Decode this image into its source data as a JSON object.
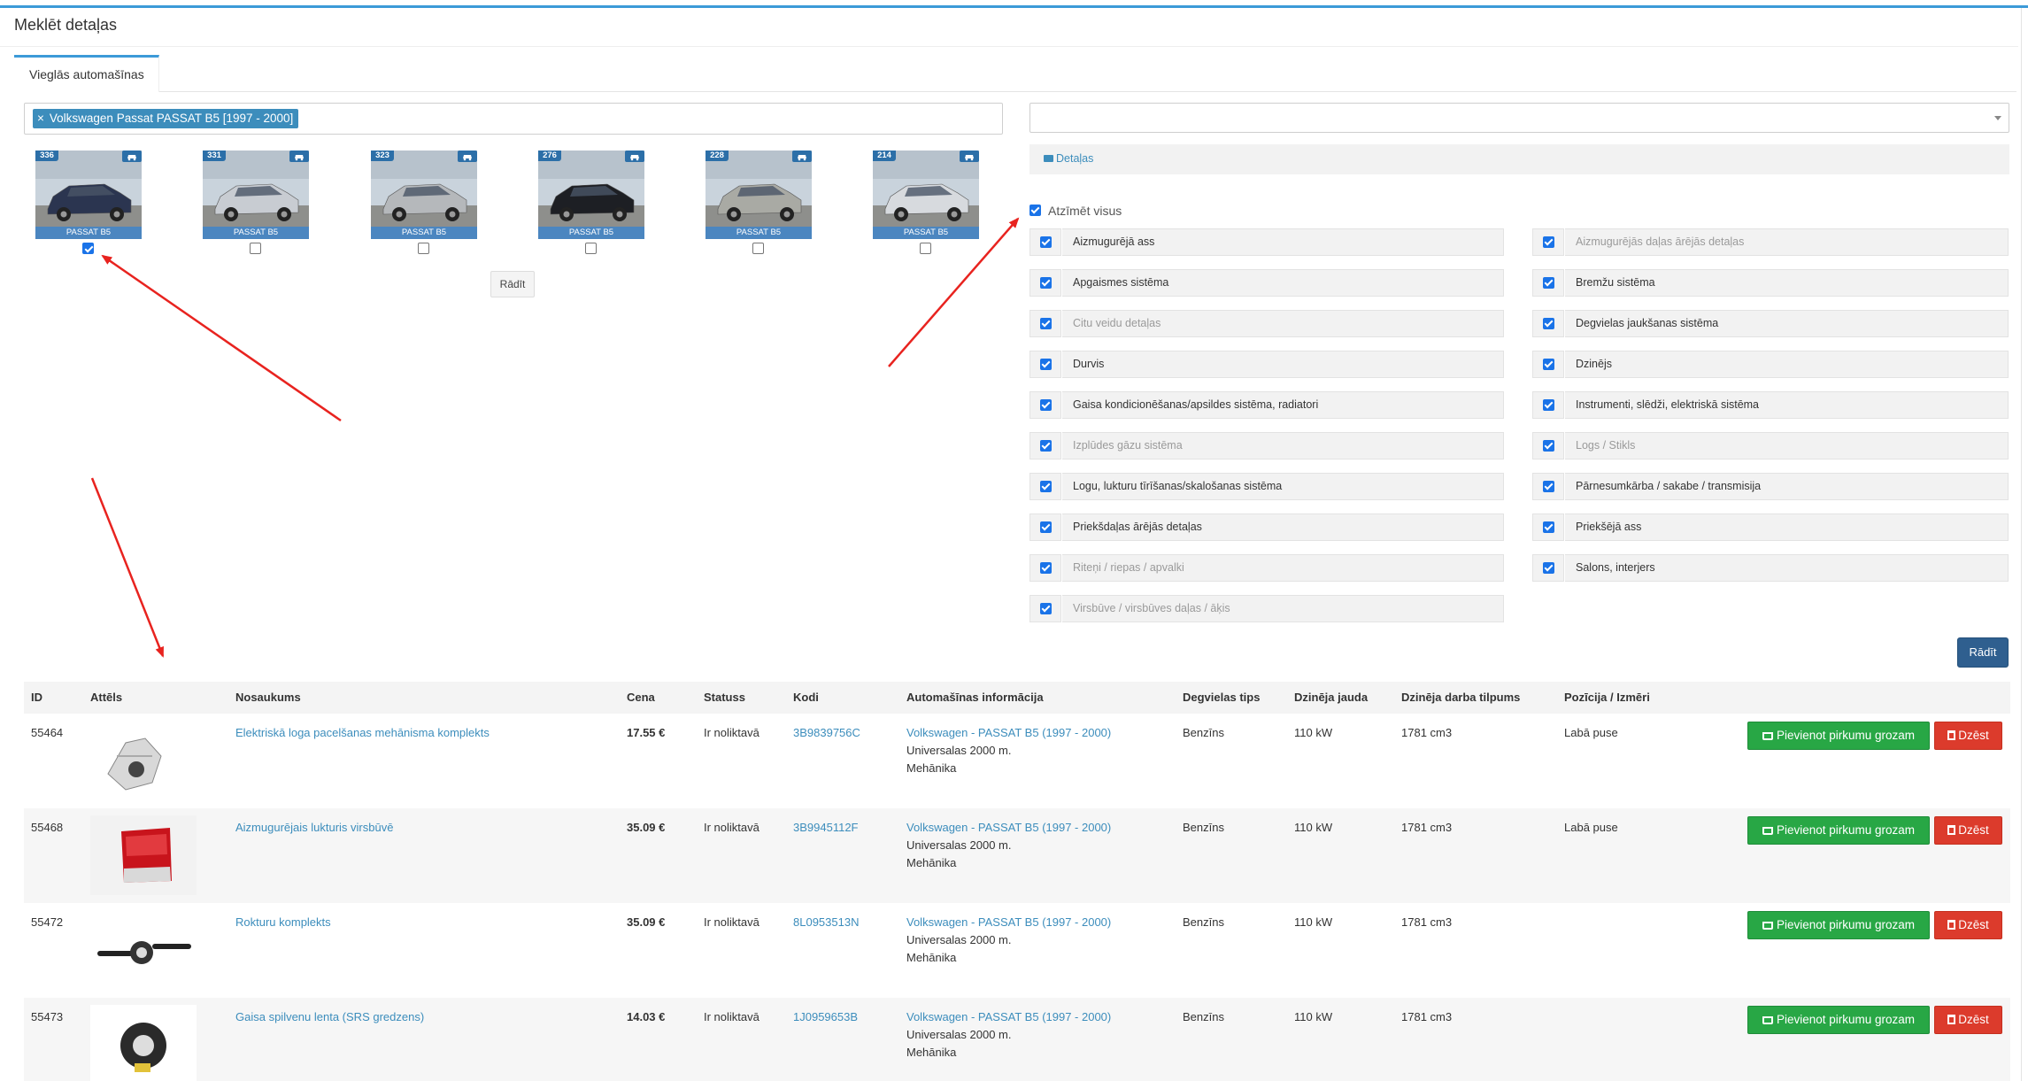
{
  "page": {
    "title": "Meklēt detaļas"
  },
  "tabs": [
    {
      "label": "Vieglās automašīnas"
    }
  ],
  "vehicle_filter": {
    "chip_remove": "×",
    "chip_label": "Volkswagen Passat PASSAT B5 [1997 - 2000]"
  },
  "cars": [
    {
      "count": "336",
      "model": "PASSAT B5",
      "checked": true,
      "color": "#2b3550"
    },
    {
      "count": "331",
      "model": "PASSAT B5",
      "checked": false,
      "color": "#c8ccd2"
    },
    {
      "count": "323",
      "model": "PASSAT B5",
      "checked": false,
      "color": "#b5b8bb"
    },
    {
      "count": "276",
      "model": "PASSAT B5",
      "checked": false,
      "color": "#1d1f24"
    },
    {
      "count": "228",
      "model": "PASSAT B5",
      "checked": false,
      "color": "#a9aaa4"
    },
    {
      "count": "214",
      "model": "PASSAT B5",
      "checked": false,
      "color": "#d7dade"
    }
  ],
  "buttons": {
    "show_small": "Rādīt",
    "show_main": "Rādīt",
    "add_to_cart": "Pievienot pirkumu grozam",
    "delete": "Dzēst"
  },
  "details_bar": {
    "label": "Detaļas"
  },
  "check_all": {
    "label": "Atzīmēt visus"
  },
  "categories_left": [
    {
      "label": "Aizmugurējā ass",
      "muted": false
    },
    {
      "label": "Apgaismes sistēma",
      "muted": false
    },
    {
      "label": "Citu veidu detaļas",
      "muted": true
    },
    {
      "label": "Durvis",
      "muted": false
    },
    {
      "label": "Gaisa kondicionēšanas/apsildes sistēma, radiatori",
      "muted": false
    },
    {
      "label": "Izplūdes gāzu sistēma",
      "muted": true
    },
    {
      "label": "Logu, lukturu tīrīšanas/skalošanas sistēma",
      "muted": false
    },
    {
      "label": "Priekšdaļas ārējās detaļas",
      "muted": false
    },
    {
      "label": "Riteņi / riepas / apvalki",
      "muted": true
    },
    {
      "label": "Virsbūve / virsbūves daļas / āķis",
      "muted": true
    }
  ],
  "categories_right": [
    {
      "label": "Aizmugurējās daļas ārējās detaļas",
      "muted": true
    },
    {
      "label": "Bremžu sistēma",
      "muted": false
    },
    {
      "label": "Degvielas jaukšanas sistēma",
      "muted": false
    },
    {
      "label": "Dzinējs",
      "muted": false
    },
    {
      "label": "Instrumenti, slēdži, elektriskā sistēma",
      "muted": false
    },
    {
      "label": "Logs / Stikls",
      "muted": true
    },
    {
      "label": "Pārnesumkārba / sakabe / transmisija",
      "muted": false
    },
    {
      "label": "Priekšējā ass",
      "muted": false
    },
    {
      "label": "Salons, interjers",
      "muted": false
    }
  ],
  "table": {
    "headers": {
      "id": "ID",
      "image": "Attēls",
      "name": "Nosaukums",
      "price": "Cena",
      "status": "Statuss",
      "code": "Kodi",
      "car_info": "Automašīnas informācija",
      "fuel": "Degvielas tips",
      "power": "Dzinēja jauda",
      "volume": "Dzinēja darba tilpums",
      "position": "Pozīcija / Izmēri"
    },
    "rows": [
      {
        "id": "55464",
        "name": "Elektriskā loga pacelšanas mehānisma komplekts",
        "price": "17.55 €",
        "status": "Ir noliktavā",
        "code": "3B9839756C",
        "car_link": "Volkswagen - PASSAT B5 (1997 - 2000)",
        "car_line2": "Universalas 2000 m.",
        "car_line3": "Mehānika",
        "fuel": "Benzīns",
        "power": "110 kW",
        "volume": "1781 cm3",
        "position": "Labā puse",
        "thumb": "window-regulator"
      },
      {
        "id": "55468",
        "name": "Aizmugurējais lukturis virsbūvē",
        "price": "35.09 €",
        "status": "Ir noliktavā",
        "code": "3B9945112F",
        "car_link": "Volkswagen - PASSAT B5 (1997 - 2000)",
        "car_line2": "Universalas 2000 m.",
        "car_line3": "Mehānika",
        "fuel": "Benzīns",
        "power": "110 kW",
        "volume": "1781 cm3",
        "position": "Labā puse",
        "thumb": "tail-light"
      },
      {
        "id": "55472",
        "name": "Rokturu komplekts",
        "price": "35.09 €",
        "status": "Ir noliktavā",
        "code": "8L0953513N",
        "car_link": "Volkswagen - PASSAT B5 (1997 - 2000)",
        "car_line2": "Universalas 2000 m.",
        "car_line3": "Mehānika",
        "fuel": "Benzīns",
        "power": "110 kW",
        "volume": "1781 cm3",
        "position": "",
        "thumb": "stalk-switch"
      },
      {
        "id": "55473",
        "name": "Gaisa spilvenu lenta (SRS gredzens)",
        "price": "14.03 €",
        "status": "Ir noliktavā",
        "code": "1J0959653B",
        "car_link": "Volkswagen - PASSAT B5 (1997 - 2000)",
        "car_line2": "Universalas 2000 m.",
        "car_line3": "Mehānika",
        "fuel": "Benzīns",
        "power": "110 kW",
        "volume": "1781 cm3",
        "position": "",
        "thumb": "clock-spring"
      }
    ]
  },
  "colors": {
    "accent": "#3c8dbc",
    "cart_green": "#28a745",
    "delete_red": "#dc3b2c",
    "annotation_arrow": "#e8231f"
  }
}
